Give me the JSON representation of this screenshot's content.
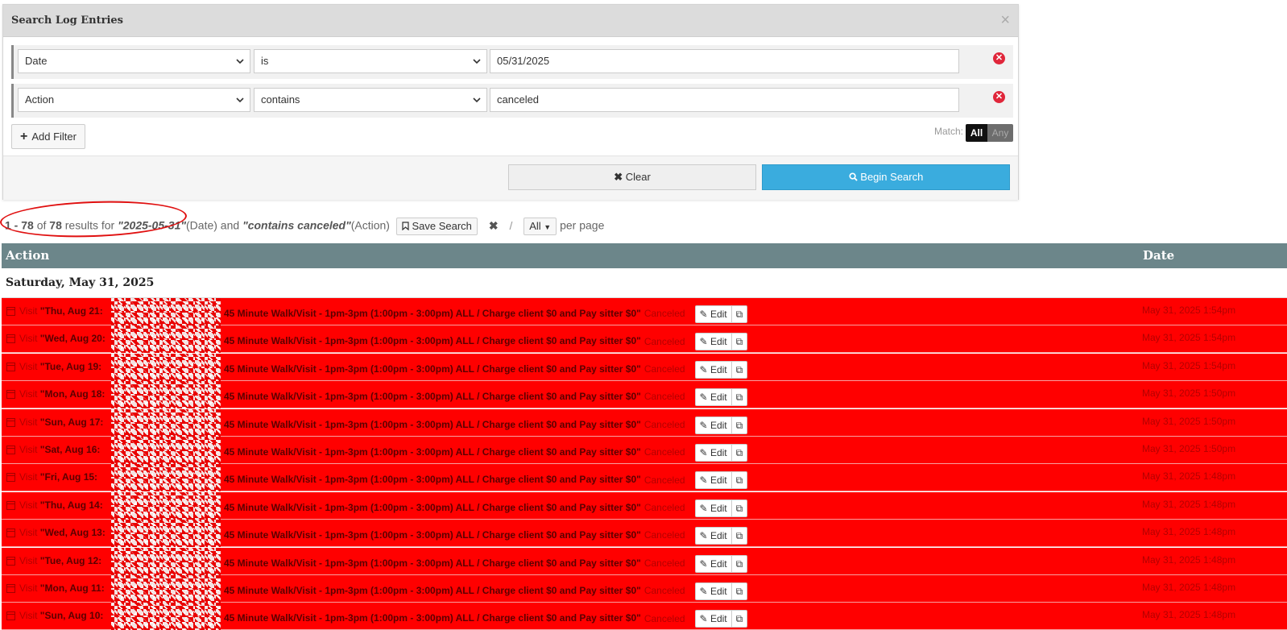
{
  "panel": {
    "title": "Search Log Entries",
    "close_glyph": "×",
    "filters": [
      {
        "field": "Date",
        "operator": "is",
        "value": "05/31/2025"
      },
      {
        "field": "Action",
        "operator": "contains",
        "value": "canceled"
      }
    ],
    "add_filter_label": "Add Filter",
    "match_label": "Match:",
    "match_all": "All",
    "match_any": "Any",
    "clear_label": "Clear",
    "search_label": "Begin Search"
  },
  "summary": {
    "range": "1 - 78",
    "of_text": "of",
    "total": "78",
    "results_for": "results for",
    "date_query": "2025-05-31",
    "date_field": "(Date) and",
    "action_query": "contains canceled",
    "action_field": "(Action)",
    "save_search_label": "Save Search",
    "per_page_value": "All",
    "per_page_label": "per page"
  },
  "table": {
    "col_action": "Action",
    "col_date": "Date",
    "day_heading": "Saturday, May 31, 2025",
    "rows": [
      {
        "kind": "Visit",
        "day": "\"Thu, Aug 21:",
        "desc": "45 Minute Walk/Visit - 1pm-3pm (1:00pm - 3:00pm) ALL / Charge client $0 and Pay sitter $0\"",
        "status": "Canceled",
        "date": "May 31, 2025 1:54pm"
      },
      {
        "kind": "Visit",
        "day": "\"Wed, Aug 20:",
        "desc": "45 Minute Walk/Visit - 1pm-3pm (1:00pm - 3:00pm) ALL / Charge client $0 and Pay sitter $0\"",
        "status": "Canceled",
        "date": "May 31, 2025 1:54pm"
      },
      {
        "kind": "Visit",
        "day": "\"Tue, Aug 19:",
        "desc": "45 Minute Walk/Visit - 1pm-3pm (1:00pm - 3:00pm) ALL / Charge client $0 and Pay sitter $0\"",
        "status": "Canceled",
        "date": "May 31, 2025 1:54pm"
      },
      {
        "kind": "Visit",
        "day": "\"Mon, Aug 18:",
        "desc": "45 Minute Walk/Visit - 1pm-3pm (1:00pm - 3:00pm) ALL / Charge client $0 and Pay sitter $0\"",
        "status": "Canceled",
        "date": "May 31, 2025 1:50pm"
      },
      {
        "kind": "Visit",
        "day": "\"Sun, Aug 17:",
        "desc": "45 Minute Walk/Visit - 1pm-3pm (1:00pm - 3:00pm) ALL / Charge client $0 and Pay sitter $0\"",
        "status": "Canceled",
        "date": "May 31, 2025 1:50pm"
      },
      {
        "kind": "Visit",
        "day": "\"Sat, Aug 16:",
        "desc": "45 Minute Walk/Visit - 1pm-3pm (1:00pm - 3:00pm) ALL / Charge client $0 and Pay sitter $0\"",
        "status": "Canceled",
        "date": "May 31, 2025 1:50pm"
      },
      {
        "kind": "Visit",
        "day": "\"Fri, Aug 15:",
        "desc": "45 Minute Walk/Visit - 1pm-3pm (1:00pm - 3:00pm) ALL / Charge client $0 and Pay sitter $0\"",
        "status": "Canceled",
        "date": "May 31, 2025 1:48pm"
      },
      {
        "kind": "Visit",
        "day": "\"Thu, Aug 14:",
        "desc": "45 Minute Walk/Visit - 1pm-3pm (1:00pm - 3:00pm) ALL / Charge client $0 and Pay sitter $0\"",
        "status": "Canceled",
        "date": "May 31, 2025 1:48pm"
      },
      {
        "kind": "Visit",
        "day": "\"Wed, Aug 13:",
        "desc": "45 Minute Walk/Visit - 1pm-3pm (1:00pm - 3:00pm) ALL / Charge client $0 and Pay sitter $0\"",
        "status": "Canceled",
        "date": "May 31, 2025 1:48pm"
      },
      {
        "kind": "Visit",
        "day": "\"Tue, Aug 12:",
        "desc": "45 Minute Walk/Visit - 1pm-3pm (1:00pm - 3:00pm) ALL / Charge client $0 and Pay sitter $0\"",
        "status": "Canceled",
        "date": "May 31, 2025 1:48pm"
      },
      {
        "kind": "Visit",
        "day": "\"Mon, Aug 11:",
        "desc": "45 Minute Walk/Visit - 1pm-3pm (1:00pm - 3:00pm) ALL / Charge client $0 and Pay sitter $0\"",
        "status": "Canceled",
        "date": "May 31, 2025 1:48pm"
      },
      {
        "kind": "Visit",
        "day": "\"Sun, Aug 10:",
        "desc": "45 Minute Walk/Visit - 1pm-3pm (1:00pm - 3:00pm) ALL / Charge client $0 and Pay sitter $0\"",
        "status": "Canceled",
        "date": "May 31, 2025 1:48pm"
      }
    ],
    "edit_label": "Edit"
  },
  "colors": {
    "row_bg": "#ff0000",
    "header_bg": "#6c868a",
    "search_button": "#3aacde",
    "annotation_circle": "#e01010"
  },
  "icons": [
    "close-icon",
    "chevron-down-icon",
    "remove-filter-icon",
    "plus-icon",
    "x-icon",
    "search-icon",
    "bookmark-icon",
    "caret-down-icon",
    "calendar-icon",
    "pencil-icon",
    "external-link-icon"
  ]
}
